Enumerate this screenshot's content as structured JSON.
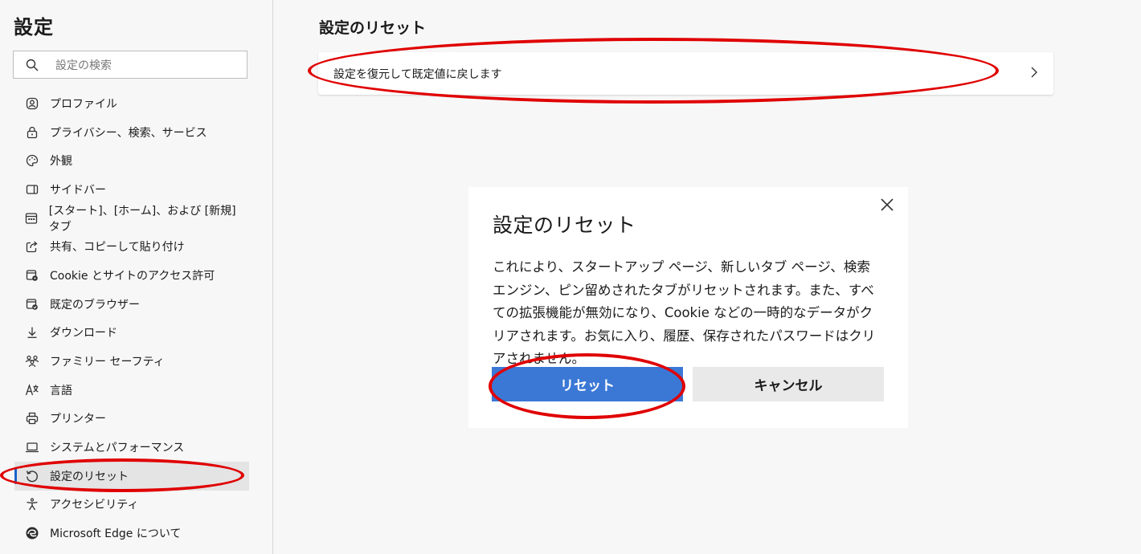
{
  "sidebar": {
    "title": "設定",
    "search_placeholder": "設定の検索",
    "items": [
      {
        "label": "プロファイル",
        "icon": "profile-icon"
      },
      {
        "label": "プライバシー、検索、サービス",
        "icon": "lock-icon"
      },
      {
        "label": "外観",
        "icon": "palette-icon"
      },
      {
        "label": "サイドバー",
        "icon": "sidebar-icon"
      },
      {
        "label": "[スタート]、[ホーム]、および [新規] タブ",
        "icon": "home-tab-icon"
      },
      {
        "label": "共有、コピーして貼り付け",
        "icon": "share-icon"
      },
      {
        "label": "Cookie とサイトのアクセス許可",
        "icon": "cookie-permissions-icon"
      },
      {
        "label": "既定のブラウザー",
        "icon": "default-browser-icon"
      },
      {
        "label": "ダウンロード",
        "icon": "download-icon"
      },
      {
        "label": "ファミリー セーフティ",
        "icon": "family-icon"
      },
      {
        "label": "言語",
        "icon": "language-icon"
      },
      {
        "label": "プリンター",
        "icon": "printer-icon"
      },
      {
        "label": "システムとパフォーマンス",
        "icon": "laptop-icon"
      },
      {
        "label": "設定のリセット",
        "icon": "reset-icon",
        "active": true
      },
      {
        "label": "アクセシビリティ",
        "icon": "accessibility-icon"
      },
      {
        "label": "Microsoft Edge について",
        "icon": "edge-icon"
      }
    ]
  },
  "main": {
    "title": "設定のリセット",
    "restore_label": "設定を復元して既定値に戻します"
  },
  "dialog": {
    "title": "設定のリセット",
    "body": "これにより、スタートアップ ページ、新しいタブ ページ、検索エンジン、ピン留めされたタブがリセットされます。また、すべての拡張機能が無効になり、Cookie などの一時的なデータがクリアされます。お気に入り、履歴、保存されたパスワードはクリアされません。",
    "reset_label": "リセット",
    "cancel_label": "キャンセル"
  },
  "colors": {
    "accent": "#3b78d6",
    "annotation": "#e00000"
  }
}
